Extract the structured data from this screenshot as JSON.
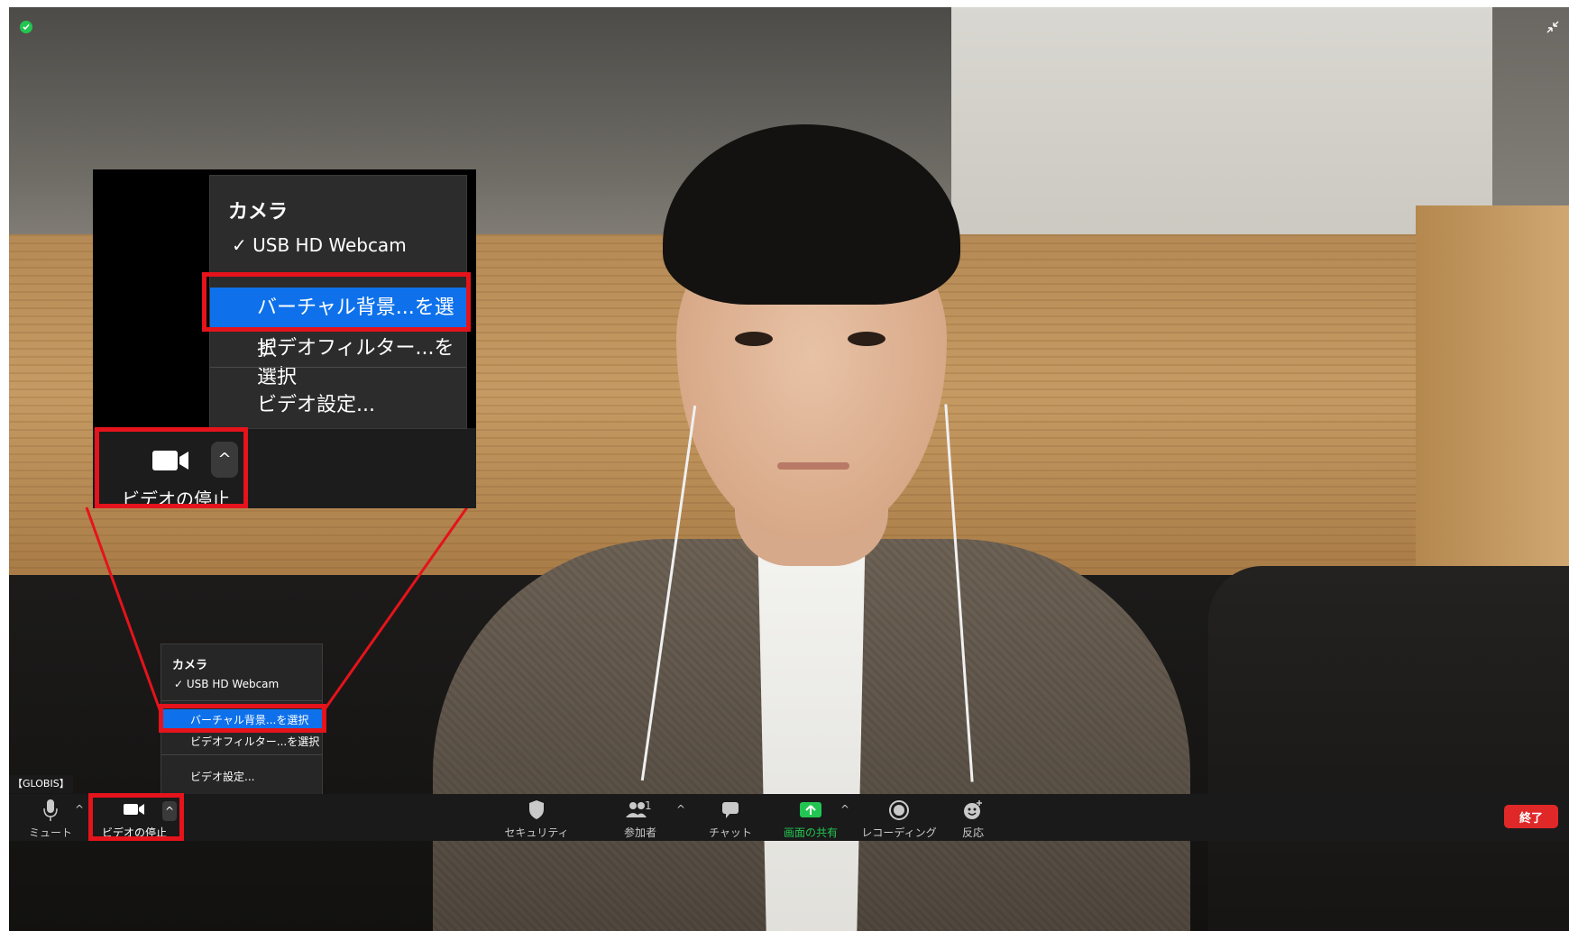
{
  "inset": {
    "menu_title": "カメラ",
    "camera_item": "USB HD Webcam",
    "virtual_bg": "バーチャル背景...を選択",
    "video_filter": "ビデオフィルター...を選択",
    "video_settings": "ビデオ設定...",
    "stop_video_label": "ビデオの停止"
  },
  "menu": {
    "title": "カメラ",
    "camera_item": "USB HD Webcam",
    "virtual_bg": "バーチャル背景...を選択",
    "video_filter": "ビデオフィルター...を選択",
    "video_settings": "ビデオ設定..."
  },
  "meeting_label": "【GLOBIS】",
  "toolbar": {
    "mute": "ミュート",
    "stop_video": "ビデオの停止",
    "security": "セキュリティ",
    "participants": "参加者",
    "participants_count": "1",
    "chat": "チャット",
    "share_screen": "画面の共有",
    "recording": "レコーディング",
    "reactions": "反応",
    "end": "終了"
  },
  "colors": {
    "highlight": "#0e71eb",
    "annotation_red": "#e5131b",
    "share_green": "#23c552",
    "end_red": "#e02828",
    "toolbar_bg": "#1a1a1a"
  },
  "icons": [
    "shield-check-icon",
    "exit-fullscreen-icon",
    "microphone-icon",
    "video-camera-icon",
    "caret-up-icon",
    "security-shield-icon",
    "participants-icon",
    "chat-bubble-icon",
    "share-screen-icon",
    "record-icon",
    "reaction-icon",
    "checkmark-icon"
  ]
}
